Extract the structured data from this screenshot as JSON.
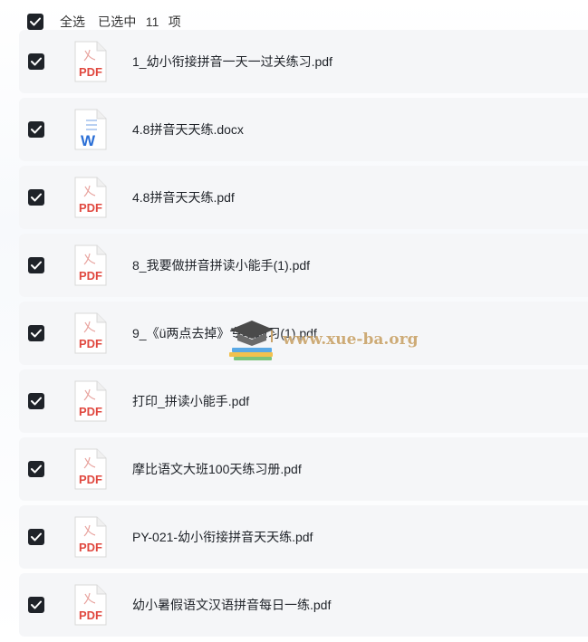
{
  "header": {
    "select_all_label": "全选",
    "selected_prefix": "已选中",
    "selected_count": "11",
    "selected_suffix": "项"
  },
  "files": [
    {
      "name": "1_幼小衔接拼音一天一过关练习.pdf",
      "type": "pdf",
      "checked": true
    },
    {
      "name": "4.8拼音天天练.docx",
      "type": "docx",
      "checked": true
    },
    {
      "name": "4.8拼音天天练.pdf",
      "type": "pdf",
      "checked": true
    },
    {
      "name": "8_我要做拼音拼读小能手(1).pdf",
      "type": "pdf",
      "checked": true
    },
    {
      "name": "9_《ü两点去掉》专项练习(1).pdf",
      "type": "pdf",
      "checked": true
    },
    {
      "name": "打印_拼读小能手.pdf",
      "type": "pdf",
      "checked": true
    },
    {
      "name": "摩比语文大班100天练习册.pdf",
      "type": "pdf",
      "checked": true
    },
    {
      "name": "PY-021-幼小衔接拼音天天练.pdf",
      "type": "pdf",
      "checked": true
    },
    {
      "name": "幼小暑假语文汉语拼音每日一练.pdf",
      "type": "pdf",
      "checked": true
    }
  ],
  "icons": {
    "pdf_label": "PDF",
    "word_label": "W"
  },
  "watermark": {
    "text": "www.xue-ba.org"
  },
  "colors": {
    "checkbox": "#1f2329",
    "pdf_red": "#e0483f",
    "word_blue": "#2b6fd6",
    "row_bg": "#f5f6f8"
  }
}
